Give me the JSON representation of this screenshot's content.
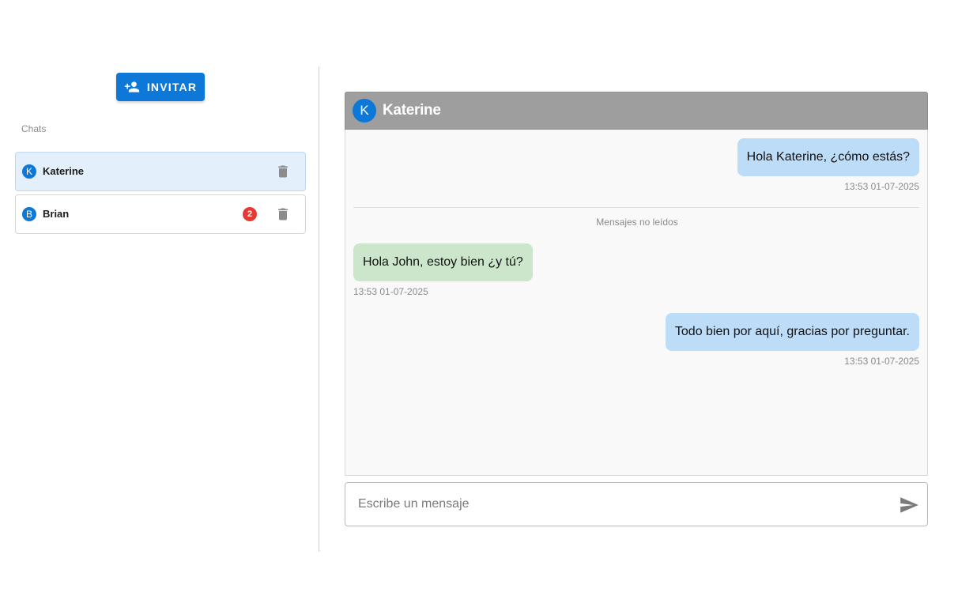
{
  "sidebar": {
    "invite_label": "INVITAR",
    "chats_label": "Chats",
    "chats": [
      {
        "initial": "K",
        "name": "Katerine",
        "unread": "",
        "active": true
      },
      {
        "initial": "B",
        "name": "Brian",
        "unread": "2",
        "active": false
      }
    ]
  },
  "conversation": {
    "contact_initial": "K",
    "contact_name": "Katerine",
    "unread_divider_label": "Mensajes no leídos",
    "messages": [
      {
        "direction": "out",
        "text": "Hola Katerine, ¿cómo estás?",
        "time": "13:53 01-07-2025"
      },
      {
        "direction": "in",
        "text": "Hola John, estoy bien ¿y tú?",
        "time": "13:53 01-07-2025"
      },
      {
        "direction": "out",
        "text": "Todo bien por aquí, gracias por preguntar.",
        "time": "13:53 01-07-2025"
      }
    ]
  },
  "composer": {
    "placeholder": "Escribe un mensaje",
    "value": ""
  },
  "colors": {
    "accent": "#0d78d8",
    "header_bg": "#9e9e9e",
    "outgoing_bubble": "#bcdcf8",
    "incoming_bubble": "#cbe6cb",
    "badge": "#e53935"
  }
}
